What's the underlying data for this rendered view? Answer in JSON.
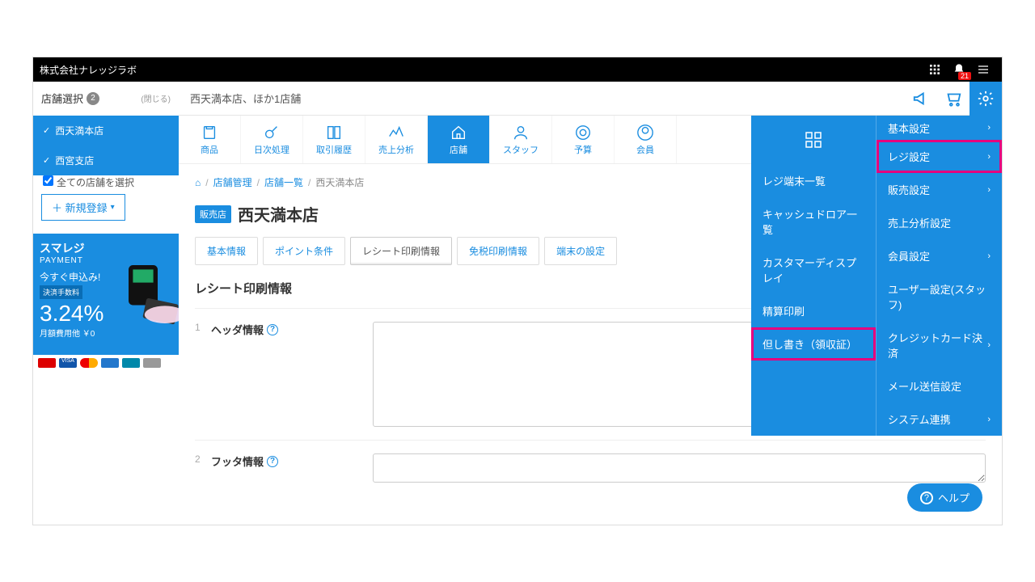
{
  "topbar": {
    "company": "株式会社ナレッジラボ",
    "notif_count": "21"
  },
  "store_selector": {
    "label": "店舗選択",
    "count": "2",
    "close": "(閉じる)",
    "current": "西天満本店、ほか1店舗"
  },
  "sidebar": {
    "items": [
      "西天満本店",
      "西宮支店"
    ],
    "all_label": "全ての店舗を選択",
    "new_btn": "＋ 新規登録"
  },
  "promo": {
    "brand": "スマレジ",
    "sub": "PAYMENT",
    "apply": "今すぐ申込み!",
    "fee_label": "決済手数料",
    "rate": "3.24%",
    "monthly": "月額費用他 ￥0"
  },
  "nav": [
    "商品",
    "日次処理",
    "取引履歴",
    "売上分析",
    "店舗",
    "スタッフ",
    "予算",
    "会員"
  ],
  "nav_active": 4,
  "breadcrumb": {
    "a": "店舗管理",
    "b": "店舗一覧",
    "c": "西天満本店"
  },
  "page": {
    "tag": "販売店",
    "title": "西天満本店"
  },
  "tabs": [
    "基本情報",
    "ポイント条件",
    "レシート印刷情報",
    "免税印刷情報",
    "端末の設定"
  ],
  "tabs_active": 2,
  "section": "レシート印刷情報",
  "fields": [
    {
      "num": "1",
      "label": "ヘッダ情報"
    },
    {
      "num": "2",
      "label": "フッタ情報"
    }
  ],
  "mega_left": [
    "レジ端末一覧",
    "キャッシュドロア一覧",
    "カスタマーディスプレイ",
    "精算印刷",
    "但し書き（領収証）"
  ],
  "mega_right": [
    "基本設定",
    "レジ設定",
    "販売設定",
    "売上分析設定",
    "会員設定",
    "ユーザー設定(スタッフ)",
    "クレジットカード決済",
    "メール送信設定",
    "システム連携"
  ],
  "help": "ヘルプ"
}
